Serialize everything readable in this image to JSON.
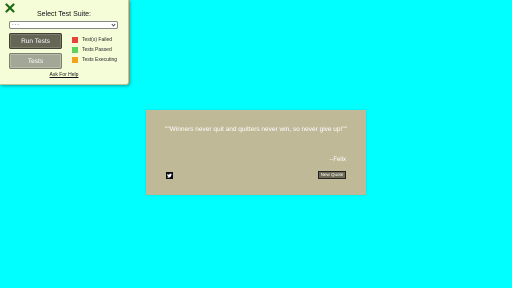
{
  "colors": {
    "background": "#00ffff",
    "panel_bg": "#f5fdd8",
    "card_bg": "#c0b997",
    "close_icon": "#1f6b14",
    "failed": "#e8433a",
    "passed": "#5fd25a",
    "executing": "#f2a21b"
  },
  "panel": {
    "close_icon": "close-icon",
    "title": "Select Test Suite:",
    "select_value": "- - -",
    "run_button": "Run Tests",
    "tests_button": "Tests",
    "legend": [
      {
        "label": "Test(s) Failed",
        "color": "#e8433a"
      },
      {
        "label": "Tests Passed",
        "color": "#5fd25a"
      },
      {
        "label": "Tests Executing",
        "color": "#f2a21b"
      }
    ],
    "help_link": "Ask For Help"
  },
  "card": {
    "quote": "\"\"Winners never quit and quitters never win, so never give up!\"\"",
    "author": "--Felix",
    "tweet_icon": "twitter-icon",
    "new_quote_button": "New Quote"
  }
}
